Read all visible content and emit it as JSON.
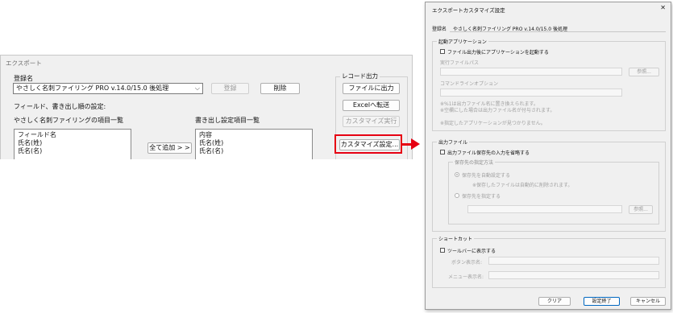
{
  "export_window": {
    "title": "エクスポート",
    "registration_label": "登録名",
    "registration_value": "やさしく名刺ファイリング PRO v.14.0/15.0 後処理",
    "register_button": "登録",
    "delete_button": "削除",
    "field_order_label": "フィールド、書き出し順の設定:",
    "source_list_title": "やさしく名刺ファイリングの項目一覧",
    "source_items": [
      "フィールド名",
      "氏名(姓)",
      "氏名(名)"
    ],
    "add_all_button": "全て追加 > >",
    "dest_list_title": "書き出し設定項目一覧",
    "dest_items": [
      "内容",
      "氏名(姓)",
      "氏名(名)"
    ],
    "record_output_label": "レコード出力",
    "file_output_button": "ファイルに出力",
    "excel_transfer_button": "Excelへ転送",
    "customize_run_button": "カスタマイズ実行",
    "customize_settings_button": "カスタマイズ設定..."
  },
  "customize_dialog": {
    "title": "エクスポートカスタマイズ設定",
    "close_glyph": "✕",
    "registration_label": "登録名",
    "registration_value": "やさしく名刺ファイリング PRO v.14.0/15.0 後処理",
    "launch_app": {
      "group_label": "起動アプリケーション",
      "checkbox_label": "ファイル出力後にアプリケーションを起動する",
      "checked": false,
      "exe_path_label": "実行ファイルパス",
      "browse_button": "参照...",
      "cmdline_label": "コマンドラインオプション",
      "note1": "※%1は出力ファイル名に置き換えられます。",
      "note2": "※空欄にした場合は出力ファイル名が付与されます。",
      "note3": "※指定したアプリケーションが見つかりません。"
    },
    "output_file": {
      "group_label": "出力ファイル",
      "checkbox_label": "出力ファイル保存先の入力を省略する",
      "checked": false,
      "dest_method_label": "保存先の指定方法",
      "radio_auto": "保存先を自動設定する",
      "radio_auto_note": "※保存したファイルは自動的に削除されます。",
      "radio_manual": "保存先を指定する",
      "selected": "auto",
      "browse_button": "参照..."
    },
    "shortcut": {
      "group_label": "ショートカット",
      "checkbox_label": "ツールバーに表示する",
      "checked": false,
      "button_label_label": "ボタン表示名:",
      "menu_label_label": "メニュー表示名:"
    },
    "clear_button": "クリア",
    "ok_button": "設定終了",
    "cancel_button": "キャンセル"
  },
  "colors": {
    "highlight": "#e60012",
    "window_bg": "#f0f0f0"
  }
}
